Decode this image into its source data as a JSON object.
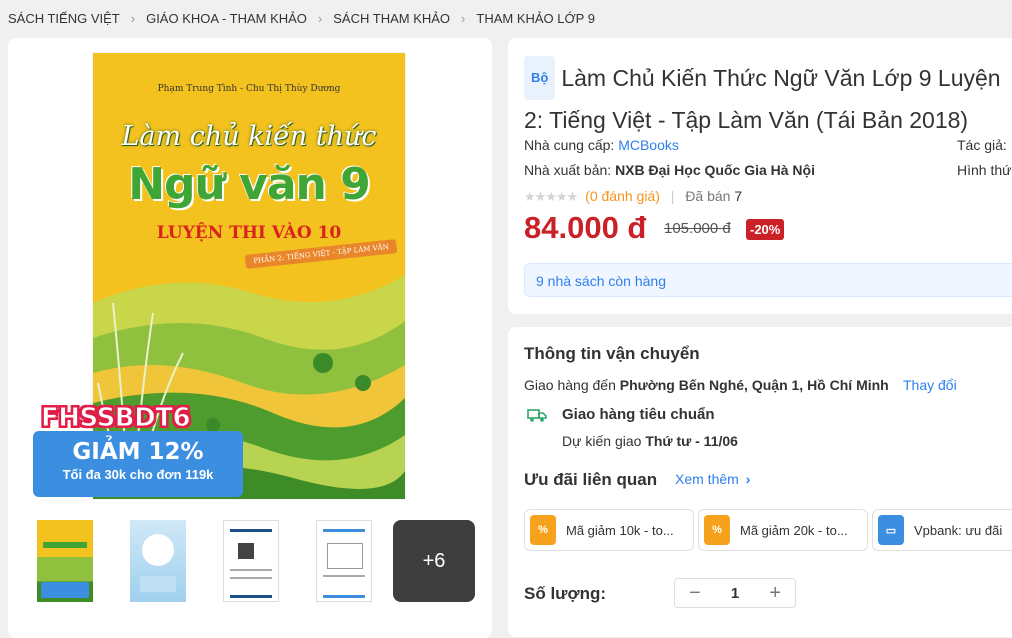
{
  "breadcrumb": [
    "SÁCH TIẾNG VIỆT",
    "GIÁO KHOA - THAM KHẢO",
    "SÁCH THAM KHẢO",
    "THAM KHẢO LỚP 9"
  ],
  "cover": {
    "authors": "Phạm Trung Tình - Chu Thị Thùy Dương",
    "title_line1": "Làm chủ kiến thức",
    "title_line2": "Ngữ văn 9",
    "title_line3": "LUYỆN THI VÀO 10",
    "tag": "PHẦN 2: TIẾNG VIỆT - TẬP LÀM VĂN"
  },
  "promo": {
    "code": "FHSSBDT6",
    "line1": "GIẢM 12%",
    "line2": "Tối đa 30k cho đơn 119k"
  },
  "thumbnails": {
    "more_label": "+6"
  },
  "product": {
    "badge": "Bộ",
    "title_line1": "Làm Chủ Kiến Thức Ngữ Văn Lớp 9 Luyện",
    "title_line2": "2: Tiếng Việt - Tập Làm Văn (Tái Bản 2018)",
    "supplier_label": "Nhà cung cấp:",
    "supplier": "MCBooks",
    "author_label": "Tác giả:",
    "publisher_label": "Nhà xuất bản:",
    "publisher": "NXB Đại Học Quốc Gia Hà Nội",
    "format_label": "Hình thứ",
    "stars": "★★★★★",
    "rating_text": "(0 đánh giá)",
    "sold_label": "Đã bán",
    "sold": "7",
    "price": "84.000 đ",
    "old_price": "105.000 đ",
    "discount": "-20%",
    "stock_text": "9 nhà sách còn hàng"
  },
  "shipping": {
    "heading": "Thông tin vận chuyển",
    "deliver_to_label": "Giao hàng đến",
    "address": "Phường Bến Nghé, Quận 1, Hồ Chí Minh",
    "change_label": "Thay đổi",
    "method": "Giao hàng tiêu chuẩn",
    "eta_label": "Dự kiến giao",
    "eta": "Thứ tư - 11/06"
  },
  "offers": {
    "heading": "Ưu đãi liên quan",
    "see_more": "Xem thêm",
    "items": [
      {
        "label": "Mã giảm 10k - to..."
      },
      {
        "label": "Mã giảm 20k - to..."
      },
      {
        "label": "Vpbank: ưu đãi"
      }
    ]
  },
  "quantity": {
    "label": "Số lượng:",
    "value": "1",
    "minus": "−",
    "plus": "+"
  },
  "colors": {
    "price_red": "#c92127",
    "link_blue": "#2f80ed",
    "orange": "#f7941d"
  }
}
